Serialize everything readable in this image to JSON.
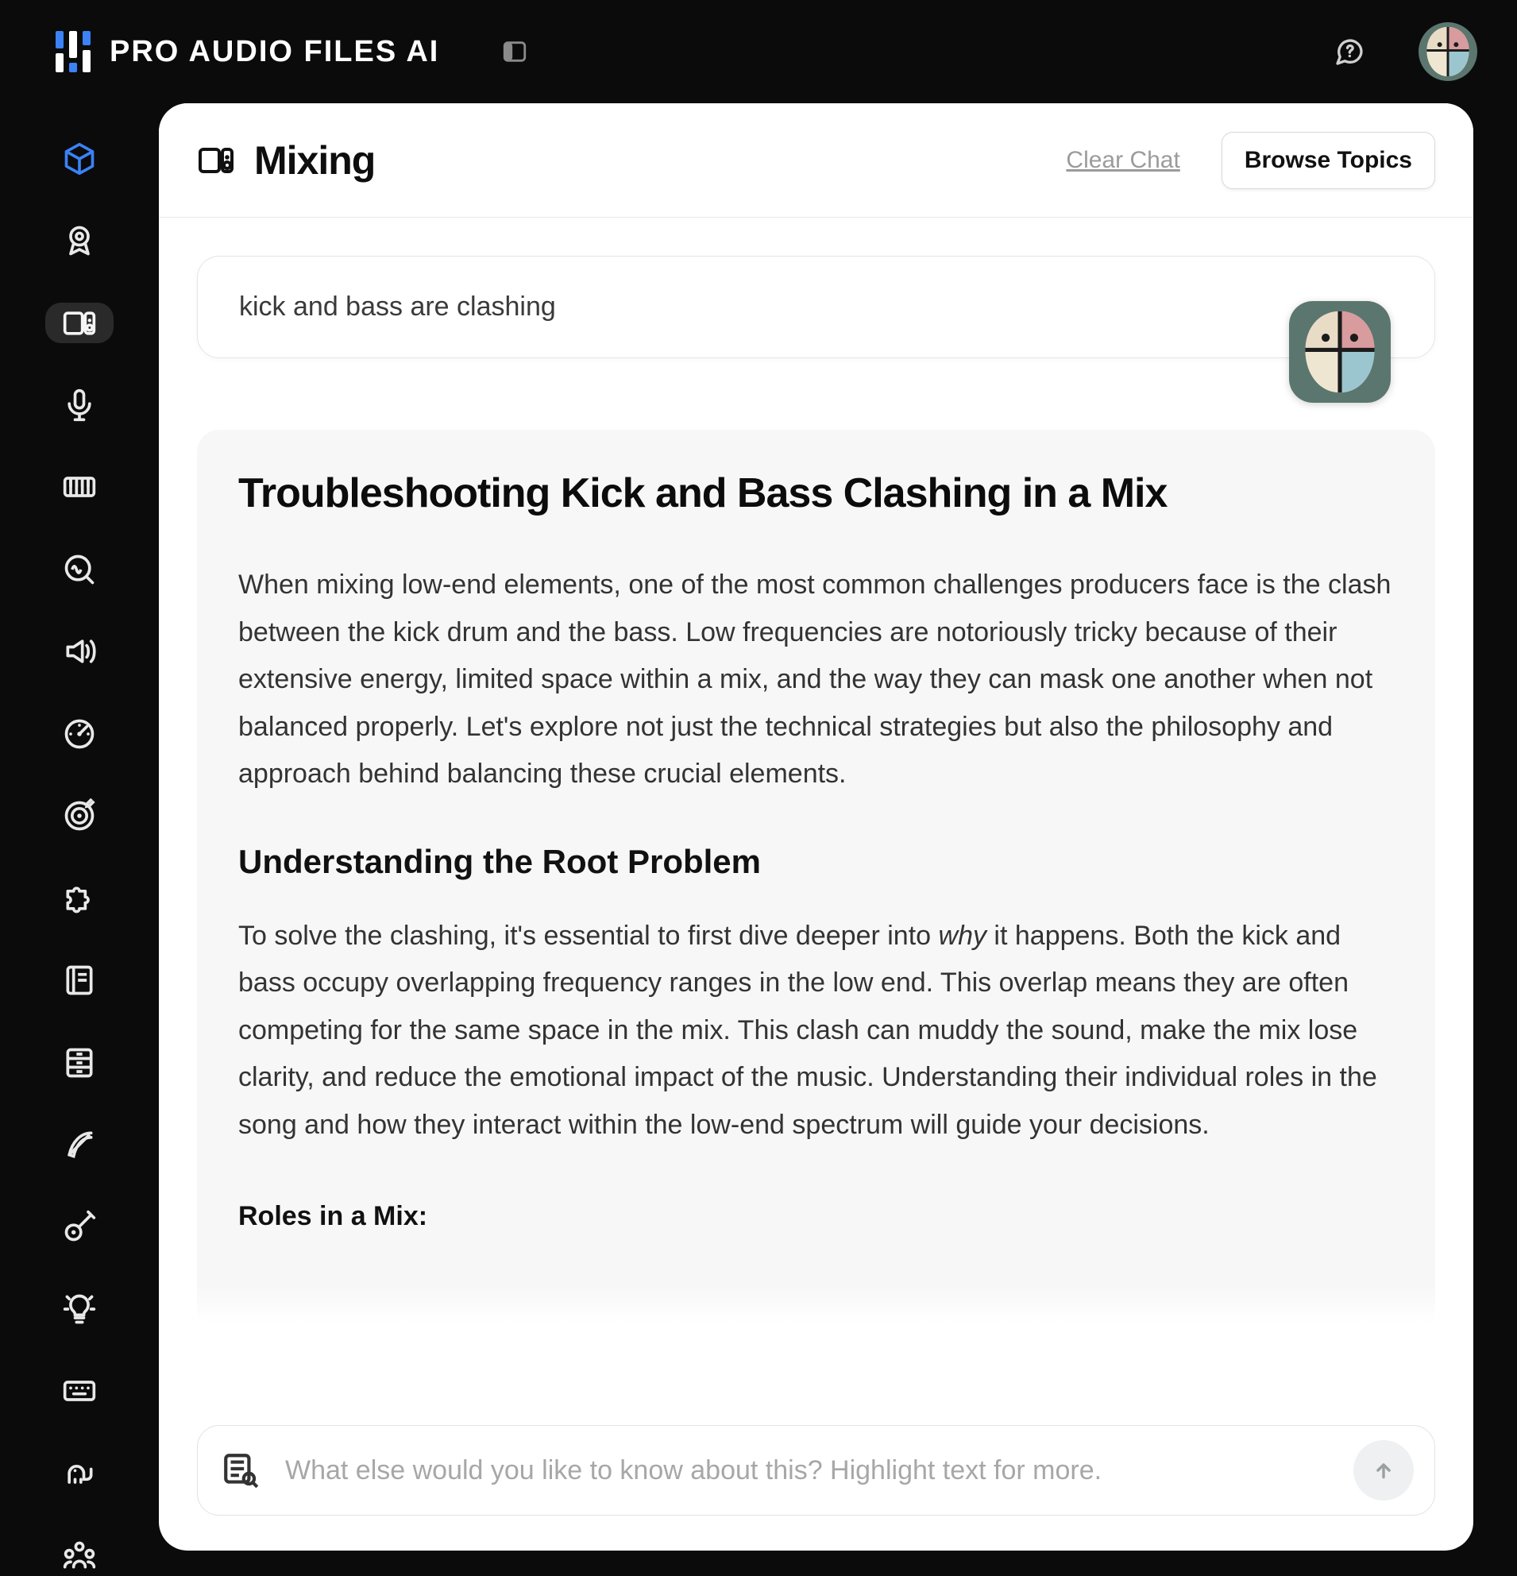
{
  "brand": {
    "name": "PRO AUDIO FILES AI"
  },
  "topbar": {
    "help_tooltip": "Help",
    "panel_toggle_tooltip": "Toggle sidebar"
  },
  "sidebar": {
    "items": [
      {
        "name": "cube-icon",
        "label": "Home",
        "accent": true,
        "active": false
      },
      {
        "name": "badge-icon",
        "label": "Achievements",
        "accent": false,
        "active": false
      },
      {
        "name": "monitor-icon",
        "label": "Mixing",
        "accent": false,
        "active": true
      },
      {
        "name": "mic-icon",
        "label": "Recording",
        "accent": false,
        "active": false
      },
      {
        "name": "piano-icon",
        "label": "Keys",
        "accent": false,
        "active": false
      },
      {
        "name": "analyze-icon",
        "label": "Analyze",
        "accent": false,
        "active": false
      },
      {
        "name": "speaker-icon",
        "label": "Monitoring",
        "accent": false,
        "active": false
      },
      {
        "name": "gauge-icon",
        "label": "Metering",
        "accent": false,
        "active": false
      },
      {
        "name": "target-icon",
        "label": "Goals",
        "accent": false,
        "active": false
      },
      {
        "name": "puzzle-icon",
        "label": "Plugins",
        "accent": false,
        "active": false
      },
      {
        "name": "book-icon",
        "label": "Library",
        "accent": false,
        "active": false
      },
      {
        "name": "archive-icon",
        "label": "Saved",
        "accent": false,
        "active": false
      },
      {
        "name": "feather-icon",
        "label": "Write",
        "accent": false,
        "active": false
      },
      {
        "name": "guitar-icon",
        "label": "Guitar",
        "accent": false,
        "active": false
      },
      {
        "name": "bulb-icon",
        "label": "Ideas",
        "accent": false,
        "active": false
      },
      {
        "name": "keyboard-icon",
        "label": "Shortcuts",
        "accent": false,
        "active": false
      },
      {
        "name": "elephant-icon",
        "label": "Memory",
        "accent": false,
        "active": false
      },
      {
        "name": "team-icon",
        "label": "Collab",
        "accent": false,
        "active": false
      }
    ]
  },
  "page": {
    "title": "Mixing",
    "clear_label": "Clear Chat",
    "browse_label": "Browse Topics"
  },
  "chat": {
    "user_message": "kick and bass are clashing"
  },
  "article": {
    "title": "Troubleshooting Kick and Bass Clashing in a Mix",
    "intro": "When mixing low-end elements, one of the most common challenges producers face is the clash between the kick drum and the bass. Low frequencies are notoriously tricky because of their extensive energy, limited space within a mix, and the way they can mask one another when not balanced properly. Let's explore not just the technical strategies but also the philosophy and approach behind balancing these crucial elements.",
    "h2_1": "Understanding the Root Problem",
    "p2_pre": "To solve the clashing, it's essential to first dive deeper into ",
    "p2_em": "why",
    "p2_post": " it happens. Both the kick and bass occupy overlapping frequency ranges in the low end. This overlap means they are often competing for the same space in the mix. This clash can muddy the sound, make the mix lose clarity, and reduce the emotional impact of the music. Understanding their individual roles in the song and how they interact within the low-end spectrum will guide your decisions.",
    "roles_heading": "Roles in a Mix:"
  },
  "composer": {
    "placeholder": "What else would you like to know about this? Highlight text for more.",
    "value": ""
  },
  "colors": {
    "accent": "#3b82f6",
    "panel_bg": "#ffffff",
    "app_bg": "#0b0b0c",
    "article_bg": "#f7f7f8"
  }
}
